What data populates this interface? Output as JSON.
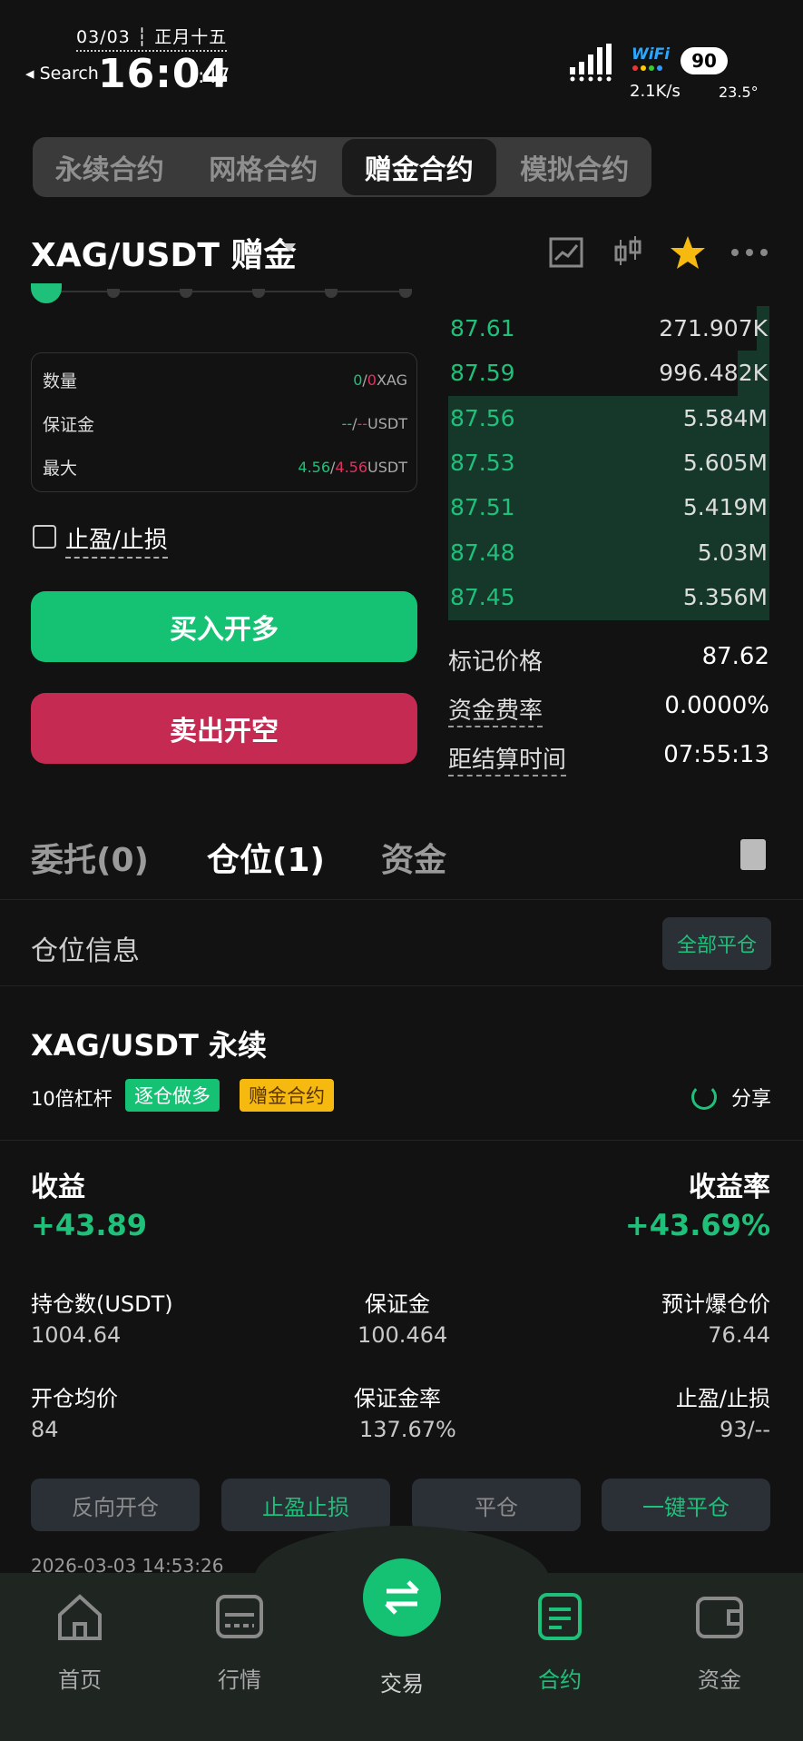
{
  "status_bar": {
    "date": "03/03 ┆ 正月十五",
    "back_label": "◂ Search",
    "time": "16:04",
    "seconds": ":47",
    "wifi": "WiFi",
    "battery": "90",
    "net_speed": "2.1K/s",
    "temperature": "23.5°"
  },
  "tabs": [
    "永续合约",
    "网格合约",
    "赠金合约",
    "模拟合约"
  ],
  "pair": {
    "name": "XAG/USDT 赠金"
  },
  "info": {
    "rows": [
      {
        "label": "数量",
        "val_a": "0",
        "sep": "/",
        "val_b": "0",
        "unit": "XAG"
      },
      {
        "label": "保证金",
        "val_a": "--",
        "sep": "/",
        "val_b": "--",
        "unit": "USDT"
      },
      {
        "label": "最大",
        "val_a": "4.56",
        "sep": "/",
        "val_b": "4.56",
        "unit": "USDT"
      }
    ]
  },
  "tpsl_label": "止盈/止损",
  "buy_label": "买入开多",
  "sell_label": "卖出开空",
  "orderbook": [
    {
      "price": "87.61",
      "qty": "271.907K",
      "depth": 0.04
    },
    {
      "price": "87.59",
      "qty": "996.482K",
      "depth": 0.1
    },
    {
      "price": "87.56",
      "qty": "5.584M",
      "depth": 1.0
    },
    {
      "price": "87.53",
      "qty": "5.605M",
      "depth": 1.0
    },
    {
      "price": "87.51",
      "qty": "5.419M",
      "depth": 1.0
    },
    {
      "price": "87.48",
      "qty": "5.03M",
      "depth": 1.0
    },
    {
      "price": "87.45",
      "qty": "5.356M",
      "depth": 1.0
    }
  ],
  "stats": [
    {
      "label": "标记价格",
      "value": "87.62"
    },
    {
      "label": "资金费率",
      "value": "0.0000%"
    },
    {
      "label": "距结算时间",
      "value": "07:55:13"
    }
  ],
  "pos_tabs": [
    "委托(0)",
    "仓位(1)",
    "资金"
  ],
  "section_title": "仓位信息",
  "close_all": "全部平仓",
  "position": {
    "title": "XAG/USDT 永续",
    "leverage": "10倍杠杆",
    "tag1": "逐仓做多",
    "tag2": "赠金合约",
    "share": "分享",
    "pnl_label": "收益",
    "pnl_value": "+43.89",
    "roi_label": "收益率",
    "roi_value": "+43.69%",
    "fields": [
      {
        "k": "持仓数(USDT)",
        "v": "1004.64"
      },
      {
        "k": "保证金",
        "v": "100.464"
      },
      {
        "k": "预计爆仓价",
        "v": "76.44"
      },
      {
        "k": "开仓均价",
        "v": "84"
      },
      {
        "k": "保证金率",
        "v": "137.67%"
      },
      {
        "k": "止盈/止损",
        "v": "93/--"
      }
    ],
    "actions": [
      "反向开仓",
      "止盈止损",
      "平仓",
      "一键平仓"
    ],
    "timestamp": "2026-03-03 14:53:26"
  },
  "nav": [
    "首页",
    "行情",
    "交易",
    "合约",
    "资金"
  ],
  "colors": {
    "green": "#1fc07a",
    "red": "#e0325f",
    "yellow": "#f5b90f"
  }
}
